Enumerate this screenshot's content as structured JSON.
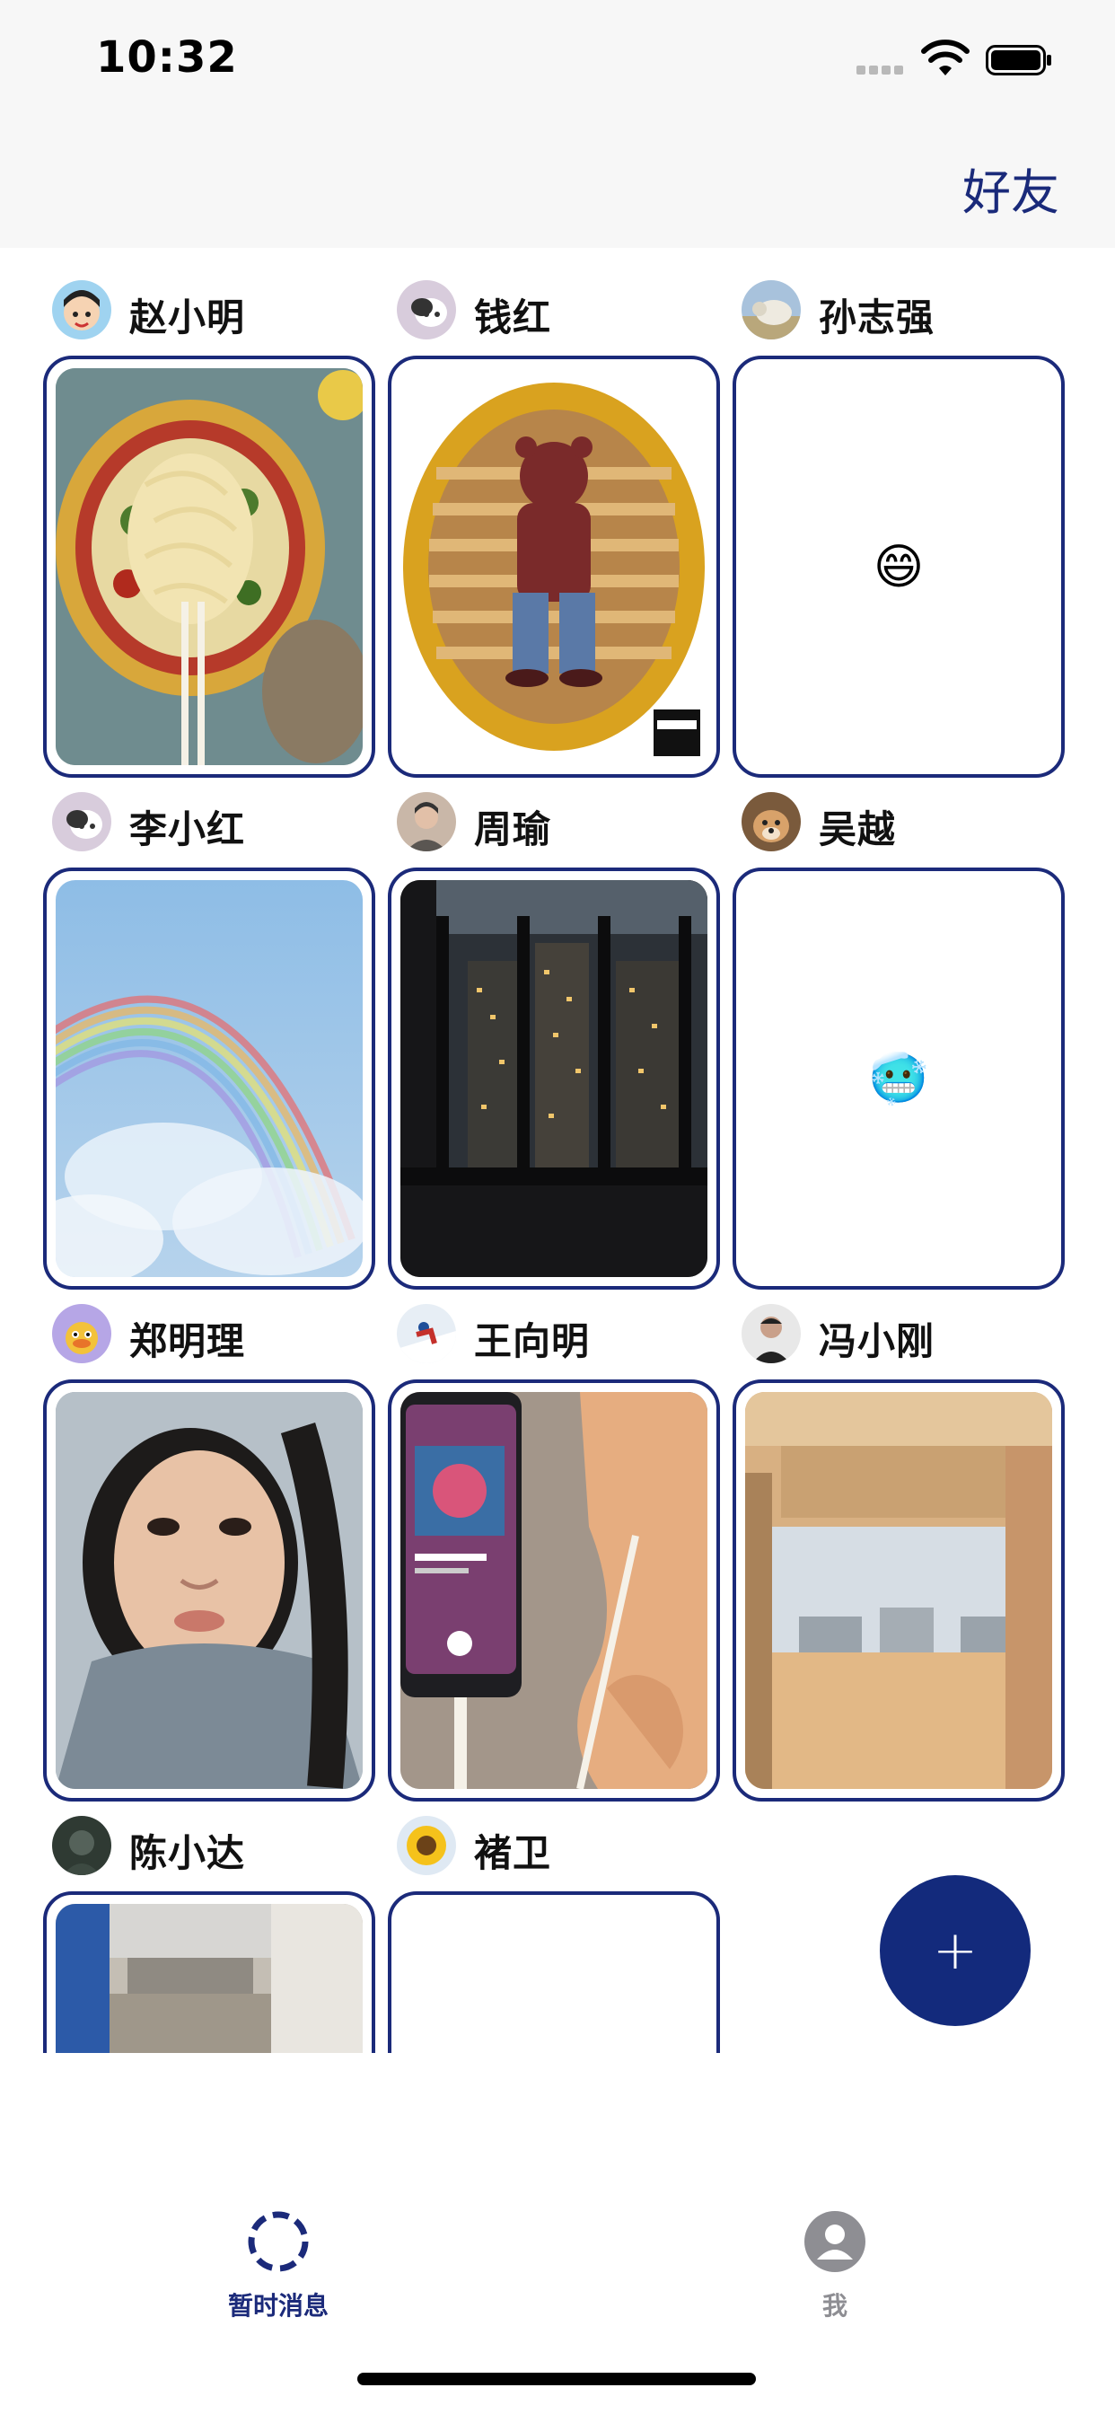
{
  "status_bar": {
    "time": "10:32"
  },
  "nav": {
    "right_link": "好友"
  },
  "friends": [
    {
      "name": "赵小明",
      "avatar_icon": "cartoon-boy-avatar",
      "content": "photo-noodles"
    },
    {
      "name": "钱红",
      "avatar_icon": "cartoon-cat-avatar",
      "content": "photo-album-bear"
    },
    {
      "name": "孙志强",
      "avatar_icon": "sheep-avatar",
      "content": "emoji",
      "emoji": "😄"
    },
    {
      "name": "李小红",
      "avatar_icon": "cartoon-cat-avatar",
      "content": "photo-rainbow"
    },
    {
      "name": "周瑜",
      "avatar_icon": "person-avatar",
      "content": "photo-window-night"
    },
    {
      "name": "吴越",
      "avatar_icon": "dog-avatar",
      "content": "emoji",
      "emoji": "🥶"
    },
    {
      "name": "郑明理",
      "avatar_icon": "cartoon-duck-avatar",
      "content": "photo-portrait"
    },
    {
      "name": "王向明",
      "avatar_icon": "skier-avatar",
      "content": "photo-phone-music"
    },
    {
      "name": "冯小刚",
      "avatar_icon": "man-avatar",
      "content": "photo-balcony"
    },
    {
      "name": "陈小达",
      "avatar_icon": "dark-avatar",
      "content": "photo-office"
    },
    {
      "name": "褚卫",
      "avatar_icon": "sunflower-avatar",
      "content": "empty"
    }
  ],
  "fab": {
    "label": "+"
  },
  "tabs": [
    {
      "label": "暂时消息",
      "icon": "dashed-circle-icon",
      "active": true
    },
    {
      "label": "我",
      "icon": "person-icon",
      "active": false
    }
  ],
  "colors": {
    "accent": "#1b2a7a",
    "inactive": "#8e8e93"
  }
}
